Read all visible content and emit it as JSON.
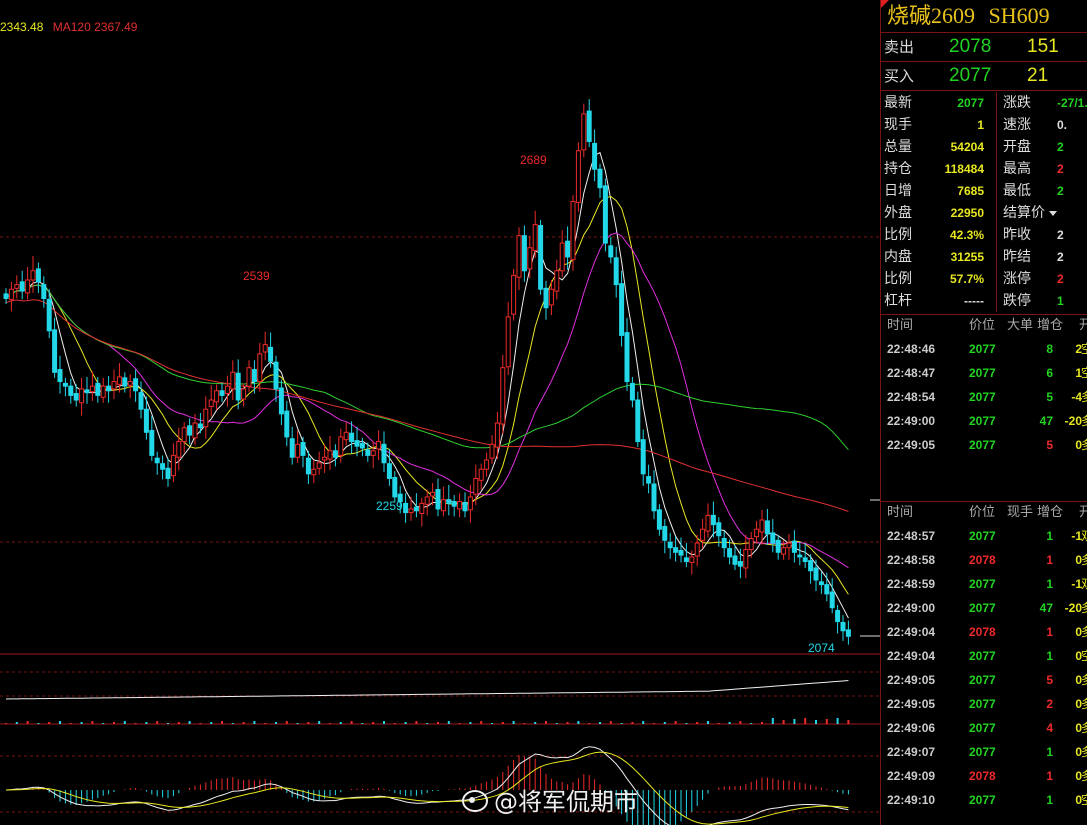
{
  "legend": {
    "ma_a": "2343.48",
    "ma120": "MA120 2367.49"
  },
  "annotations": {
    "high_2539": "2539",
    "high_2689": "2689",
    "low_2259": "2259",
    "low_2074": "2074"
  },
  "instrument": {
    "name": "烧碱2609",
    "code": "SH609"
  },
  "quote": {
    "sell_label": "卖出",
    "sell_price": "2078",
    "sell_vol": "151",
    "buy_label": "买入",
    "buy_price": "2077",
    "buy_vol": "21"
  },
  "stats": [
    {
      "k1": "最新",
      "v1": "2077",
      "c1": "g",
      "k2": "涨跌",
      "v2": "-27/1.",
      "c2": "g"
    },
    {
      "k1": "现手",
      "v1": "1",
      "c1": "y",
      "k2": "速涨",
      "v2": "0.",
      "c2": "w"
    },
    {
      "k1": "总量",
      "v1": "54204",
      "c1": "y",
      "k2": "开盘",
      "v2": "2",
      "c2": "g"
    },
    {
      "k1": "持仓",
      "v1": "118484",
      "c1": "y",
      "k2": "最高",
      "v2": "2",
      "c2": "r"
    },
    {
      "k1": "日增",
      "v1": "7685",
      "c1": "y",
      "k2": "最低",
      "v2": "2",
      "c2": "g"
    },
    {
      "k1": "外盘",
      "v1": "22950",
      "c1": "y",
      "k2": "结算价",
      "v2": "",
      "c2": "w"
    },
    {
      "k1": "比例",
      "v1": "42.3%",
      "c1": "y",
      "k2": "昨收",
      "v2": "2",
      "c2": "w"
    },
    {
      "k1": "内盘",
      "v1": "31255",
      "c1": "y",
      "k2": "昨结",
      "v2": "2",
      "c2": "w"
    },
    {
      "k1": "比例",
      "v1": "57.7%",
      "c1": "y",
      "k2": "涨停",
      "v2": "2",
      "c2": "r"
    },
    {
      "k1": "杠杆",
      "v1": "-----",
      "c1": "w",
      "k2": "跌停",
      "v2": "1",
      "c2": "g"
    }
  ],
  "big_orders": {
    "headers": [
      "时间",
      "价位",
      "大单",
      "增仓",
      "开"
    ],
    "rows": [
      {
        "time": "22:48:46",
        "price": "2077",
        "vol": "8",
        "vc": "g",
        "chg": "2",
        "cc": "y",
        "nat": "空"
      },
      {
        "time": "22:48:47",
        "price": "2077",
        "vol": "6",
        "vc": "g",
        "chg": "1",
        "cc": "y",
        "nat": "空"
      },
      {
        "time": "22:48:54",
        "price": "2077",
        "vol": "5",
        "vc": "g",
        "chg": "-4",
        "cc": "y",
        "nat": "多"
      },
      {
        "time": "22:49:00",
        "price": "2077",
        "vol": "47",
        "vc": "g",
        "chg": "-20",
        "cc": "y",
        "nat": "多"
      },
      {
        "time": "22:49:05",
        "price": "2077",
        "vol": "5",
        "vc": "r",
        "chg": "0",
        "cc": "y",
        "nat": "多"
      }
    ]
  },
  "ticks": {
    "headers": [
      "时间",
      "价位",
      "现手",
      "增仓",
      "开"
    ],
    "rows": [
      {
        "time": "22:48:57",
        "price": "2077",
        "vol": "1",
        "vc": "g",
        "chg": "-1",
        "cc": "y",
        "nat": "双"
      },
      {
        "time": "22:48:58",
        "price": "2078",
        "vol": "1",
        "vc": "r",
        "chg": "0",
        "cc": "y",
        "nat": "多"
      },
      {
        "time": "22:48:59",
        "price": "2077",
        "vol": "1",
        "vc": "g",
        "chg": "-1",
        "cc": "y",
        "nat": "双"
      },
      {
        "time": "22:49:00",
        "price": "2077",
        "vol": "47",
        "vc": "g",
        "chg": "-20",
        "cc": "y",
        "nat": "多"
      },
      {
        "time": "22:49:04",
        "price": "2078",
        "vol": "1",
        "vc": "r",
        "chg": "0",
        "cc": "y",
        "nat": "多"
      },
      {
        "time": "22:49:04",
        "price": "2077",
        "vol": "1",
        "vc": "g",
        "chg": "0",
        "cc": "y",
        "nat": "空"
      },
      {
        "time": "22:49:05",
        "price": "2077",
        "vol": "5",
        "vc": "r",
        "chg": "0",
        "cc": "y",
        "nat": "多"
      },
      {
        "time": "22:49:05",
        "price": "2077",
        "vol": "2",
        "vc": "r",
        "chg": "0",
        "cc": "y",
        "nat": "多"
      },
      {
        "time": "22:49:06",
        "price": "2077",
        "vol": "4",
        "vc": "r",
        "chg": "0",
        "cc": "y",
        "nat": "多"
      },
      {
        "time": "22:49:07",
        "price": "2077",
        "vol": "1",
        "vc": "g",
        "chg": "0",
        "cc": "y",
        "nat": "多"
      },
      {
        "time": "22:49:09",
        "price": "2078",
        "vol": "1",
        "vc": "r",
        "chg": "0",
        "cc": "y",
        "nat": "多"
      },
      {
        "time": "22:49:10",
        "price": "2077",
        "vol": "1",
        "vc": "g",
        "chg": "0",
        "cc": "y",
        "nat": "空"
      }
    ]
  },
  "watermark": "@将军侃期市",
  "colors": {
    "up": "#ee2a2a",
    "down": "#22d8e8",
    "grid": "#7a1414",
    "ma5": "#f0f0f0",
    "ma10": "#e8e821",
    "ma20": "#e030e0",
    "ma60": "#30d030",
    "ma120": "#e03030"
  },
  "chart_data": {
    "type": "candlestick",
    "ylim": [
      2070,
      2720
    ],
    "close": [
      2440,
      2450,
      2455,
      2448,
      2460,
      2470,
      2458,
      2440,
      2405,
      2360,
      2350,
      2345,
      2335,
      2330,
      2342,
      2338,
      2345,
      2335,
      2345,
      2340,
      2350,
      2355,
      2345,
      2350,
      2340,
      2320,
      2295,
      2270,
      2262,
      2255,
      2245,
      2270,
      2285,
      2300,
      2292,
      2305,
      2300,
      2320,
      2330,
      2340,
      2335,
      2345,
      2360,
      2330,
      2342,
      2365,
      2350,
      2380,
      2390,
      2372,
      2342,
      2315,
      2290,
      2268,
      2282,
      2270,
      2250,
      2255,
      2262,
      2268,
      2275,
      2268,
      2290,
      2295,
      2285,
      2280,
      2278,
      2270,
      2275,
      2285,
      2262,
      2245,
      2225,
      2220,
      2208,
      2212,
      2210,
      2218,
      2225,
      2230,
      2212,
      2222,
      2218,
      2215,
      2220,
      2210,
      2225,
      2245,
      2255,
      2265,
      2282,
      2305,
      2365,
      2420,
      2465,
      2508,
      2470,
      2495,
      2520,
      2450,
      2430,
      2450,
      2470,
      2500,
      2485,
      2545,
      2600,
      2640,
      2610,
      2580,
      2560,
      2500,
      2485,
      2455,
      2400,
      2350,
      2330,
      2285,
      2250,
      2240,
      2210,
      2190,
      2178,
      2170,
      2165,
      2162,
      2155,
      2160,
      2175,
      2190,
      2205,
      2195,
      2183,
      2170,
      2160,
      2152,
      2150,
      2168,
      2180,
      2190,
      2200,
      2185,
      2175,
      2165,
      2170,
      2175,
      2165,
      2160,
      2155,
      2145,
      2135,
      2130,
      2120,
      2105,
      2090,
      2080,
      2074
    ]
  }
}
